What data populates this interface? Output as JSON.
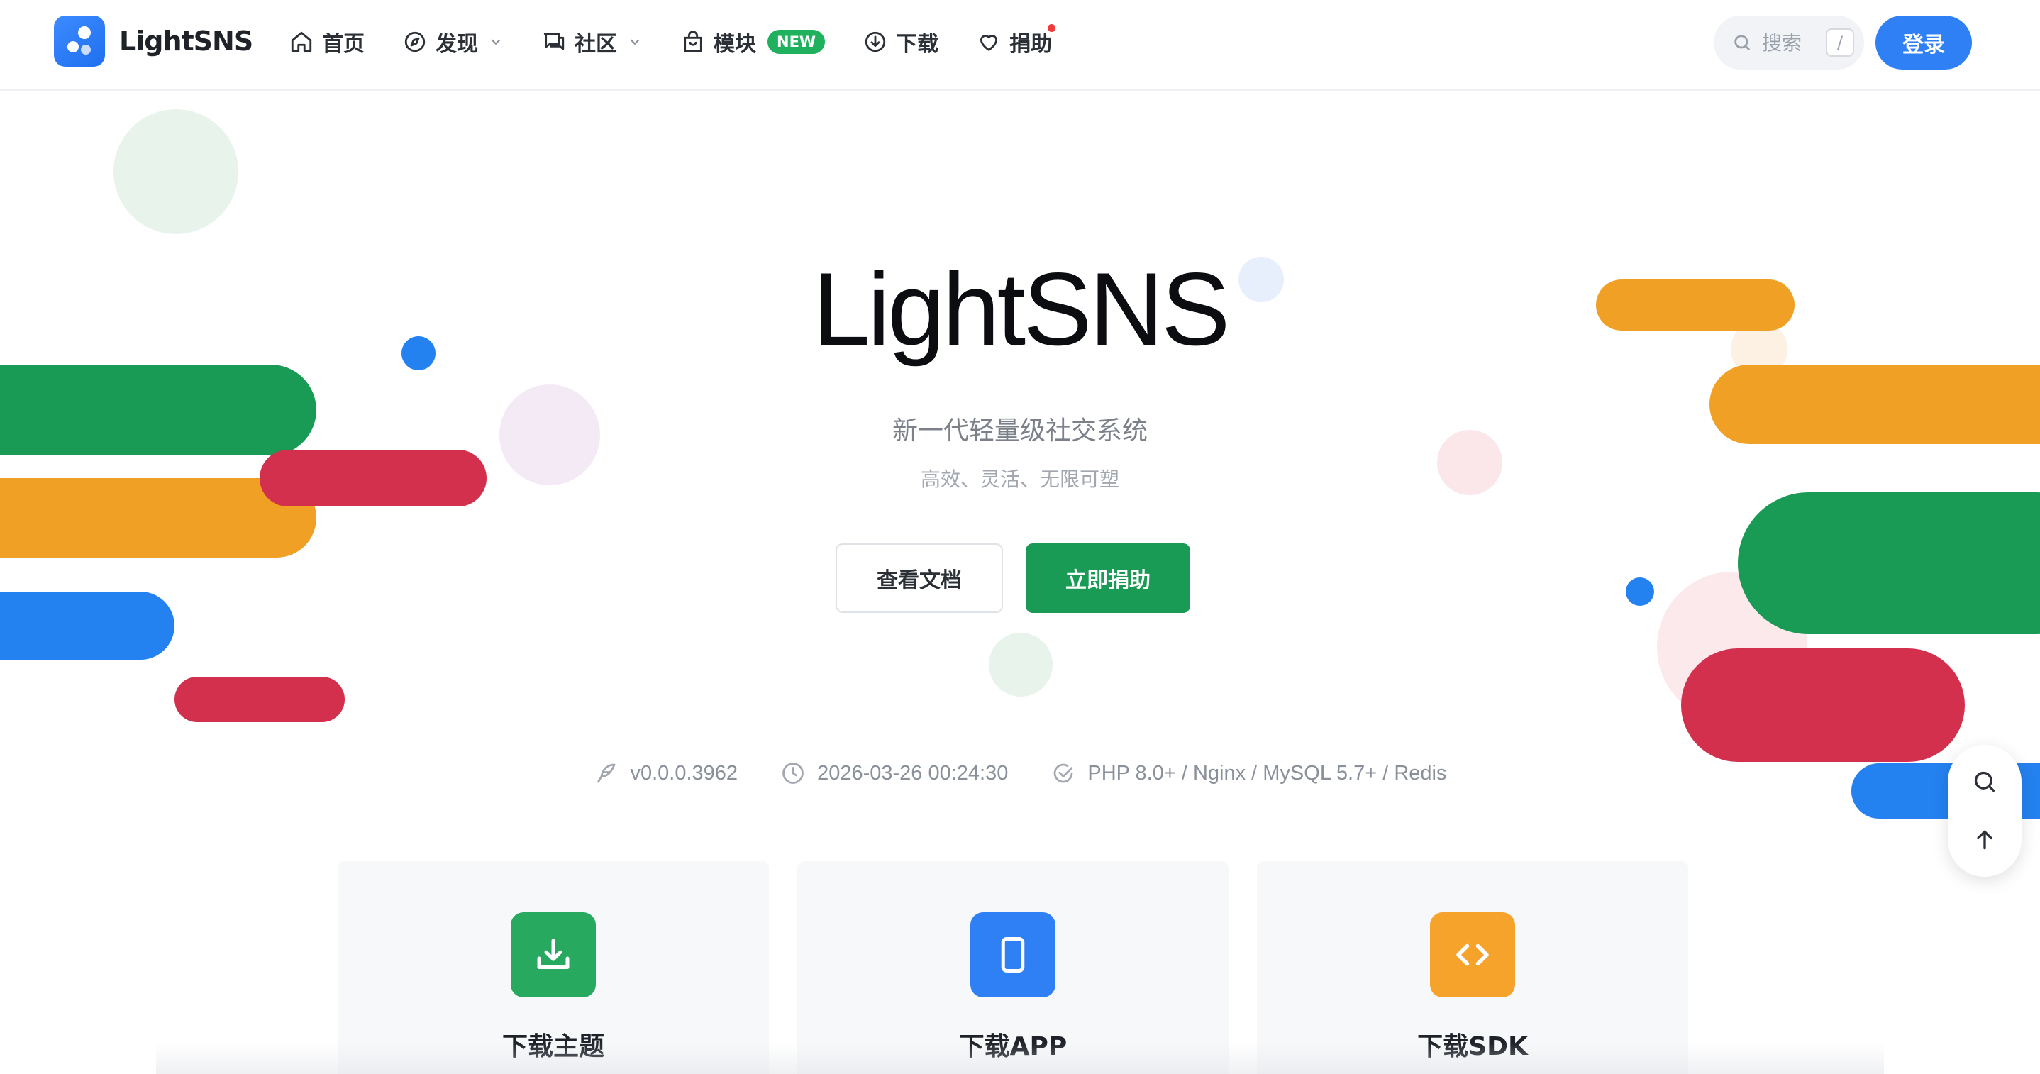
{
  "brand": {
    "name": "LightSNS",
    "accent": "#2f80f5"
  },
  "nav": {
    "items": [
      {
        "label": "首页",
        "icon": "home-icon"
      },
      {
        "label": "发现",
        "icon": "compass-icon",
        "has_dropdown": true
      },
      {
        "label": "社区",
        "icon": "chat-icon",
        "has_dropdown": true
      },
      {
        "label": "模块",
        "icon": "bag-icon",
        "badge": "NEW"
      },
      {
        "label": "下载",
        "icon": "download-cloud-icon"
      },
      {
        "label": "捐助",
        "icon": "heart-icon",
        "notification_dot": true
      }
    ]
  },
  "search": {
    "placeholder": "搜索",
    "shortcut": "/"
  },
  "auth": {
    "login_label": "登录"
  },
  "hero": {
    "title": "LightSNS",
    "subtitle": "新一代轻量级社交系统",
    "tagline": "高效、灵活、无限可塑",
    "docs_button": "查看文档",
    "donate_button": "立即捐助"
  },
  "meta": {
    "version": "v0.0.0.3962",
    "datetime": "2026-03-26 00:24:30",
    "requirements": "PHP 8.0+ / Nginx / MySQL 5.7+ / Redis"
  },
  "cards": [
    {
      "title": "下载主题",
      "icon": "download-tray-icon",
      "color": "#27a95f"
    },
    {
      "title": "下载APP",
      "icon": "phone-icon",
      "color": "#2f80f5"
    },
    {
      "title": "下载SDK",
      "icon": "code-icon",
      "color": "#f5a32a"
    }
  ],
  "float_tools": {
    "search": "search-icon",
    "top": "arrow-up-icon"
  },
  "colors": {
    "green": "#1a9b55",
    "orange": "#f0a024",
    "red": "#d3304d",
    "blue": "#2481f0"
  }
}
